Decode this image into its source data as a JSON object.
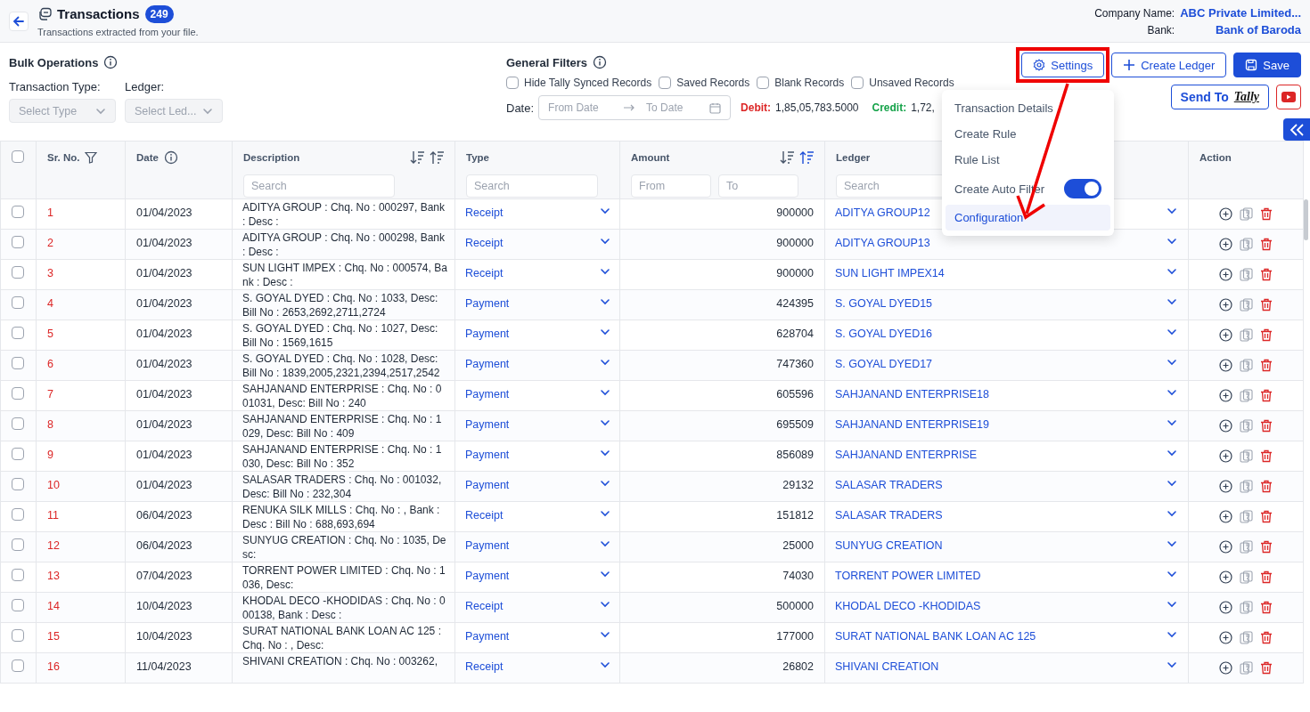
{
  "header": {
    "title": "Transactions",
    "count": "249",
    "subtitle": "Transactions extracted from your file.",
    "company_label": "Company Name:",
    "company": "ABC Private Limited...",
    "bank_label": "Bank:",
    "bank": "Bank of Baroda"
  },
  "bulk_operations": {
    "title": "Bulk Operations",
    "fields": [
      {
        "label": "Transaction Type:",
        "placeholder": "Select Type",
        "disabled": true
      },
      {
        "label": "Ledger:",
        "placeholder": "Select Led...",
        "disabled": true
      }
    ]
  },
  "general_filters": {
    "title": "General Filters",
    "checkboxes": [
      {
        "label": "Hide Tally Synced Records",
        "checked": false
      },
      {
        "label": "Saved Records",
        "checked": false
      },
      {
        "label": "Blank Records",
        "checked": false
      },
      {
        "label": "Unsaved Records",
        "checked": false
      }
    ],
    "date_label": "Date:",
    "from_placeholder": "From Date",
    "to_placeholder": "To Date",
    "debit_label": "Debit:",
    "debit": "1,85,05,783.5000",
    "credit_label": "Credit:",
    "credit": "1,72,"
  },
  "toolbar": {
    "buttons": [
      {
        "label": "Settings",
        "kind": "settings",
        "highlighted": true
      },
      {
        "label": "Create Ledger",
        "kind": "create",
        "highlighted": false
      },
      {
        "label": "Save",
        "kind": "save",
        "highlighted": false
      }
    ],
    "send_to": "Send To",
    "send_logo": "Tally"
  },
  "settings_menu": {
    "items": [
      {
        "label": "Transaction Details",
        "kind": "item",
        "selected": false
      },
      {
        "label": "Create Rule",
        "kind": "item",
        "selected": false
      },
      {
        "label": "Rule List",
        "kind": "item",
        "selected": false
      },
      {
        "label": "Create Auto Filter",
        "kind": "toggle",
        "on": true,
        "selected": false
      },
      {
        "label": "Configuration",
        "kind": "item",
        "selected": true
      }
    ]
  },
  "annotation_arrow": true,
  "table": {
    "select_all_checked": false,
    "columns": [
      {
        "label": "Sr. No.",
        "kind": "filter"
      },
      {
        "label": "Date",
        "kind": "info"
      },
      {
        "label": "Description",
        "kind": "search",
        "search_placeholder": "Search",
        "sort_ascending": false
      },
      {
        "label": "Type",
        "kind": "search",
        "search_placeholder": "Search"
      },
      {
        "label": "Amount",
        "kind": "range",
        "from_placeholder": "From",
        "to_placeholder": "To",
        "sort_ascending": true
      },
      {
        "label": "Ledger",
        "kind": "search",
        "search_placeholder": "Search"
      },
      {
        "label": "Action",
        "kind": "plain"
      }
    ],
    "rows": [
      {
        "sr": "1",
        "date": "01/04/2023",
        "description": "ADITYA GROUP : Chq. No : 000297, Bank : Desc :",
        "type": "Receipt",
        "amount": "900000",
        "ledger": "ADITYA GROUP12",
        "checked": false
      },
      {
        "sr": "2",
        "date": "01/04/2023",
        "description": "ADITYA GROUP : Chq. No : 000298, Bank : Desc :",
        "type": "Receipt",
        "amount": "900000",
        "ledger": "ADITYA GROUP13",
        "checked": false
      },
      {
        "sr": "3",
        "date": "01/04/2023",
        "description": "SUN LIGHT IMPEX : Chq. No : 000574, Bank : Desc :",
        "type": "Receipt",
        "amount": "900000",
        "ledger": "SUN LIGHT IMPEX14",
        "checked": false
      },
      {
        "sr": "4",
        "date": "01/04/2023",
        "description": "S. GOYAL DYED : Chq. No : 1033, Desc: Bill No : 2653,2692,2711,2724",
        "type": "Payment",
        "amount": "424395",
        "ledger": "S. GOYAL DYED15",
        "checked": false
      },
      {
        "sr": "5",
        "date": "01/04/2023",
        "description": "S. GOYAL DYED : Chq. No : 1027, Desc: Bill No : 1569,1615",
        "type": "Payment",
        "amount": "628704",
        "ledger": "S. GOYAL DYED16",
        "checked": false
      },
      {
        "sr": "6",
        "date": "01/04/2023",
        "description": "S. GOYAL DYED : Chq. No : 1028, Desc: Bill No : 1839,2005,2321,2394,2517,2542",
        "type": "Payment",
        "amount": "747360",
        "ledger": "S. GOYAL DYED17",
        "checked": false
      },
      {
        "sr": "7",
        "date": "01/04/2023",
        "description": "SAHJANAND ENTERPRISE : Chq. No : 001031, Desc: Bill No : 240",
        "type": "Payment",
        "amount": "605596",
        "ledger": "SAHJANAND ENTERPRISE18",
        "checked": false
      },
      {
        "sr": "8",
        "date": "01/04/2023",
        "description": "SAHJANAND ENTERPRISE : Chq. No : 1029, Desc: Bill No : 409",
        "type": "Payment",
        "amount": "695509",
        "ledger": "SAHJANAND ENTERPRISE19",
        "checked": false
      },
      {
        "sr": "9",
        "date": "01/04/2023",
        "description": "SAHJANAND ENTERPRISE : Chq. No : 1030, Desc: Bill No : 352",
        "type": "Payment",
        "amount": "856089",
        "ledger": "SAHJANAND ENTERPRISE",
        "checked": false
      },
      {
        "sr": "10",
        "date": "01/04/2023",
        "description": "SALASAR TRADERS : Chq. No : 001032, Desc: Bill No : 232,304",
        "type": "Payment",
        "amount": "29132",
        "ledger": "SALASAR TRADERS",
        "checked": false
      },
      {
        "sr": "11",
        "date": "06/04/2023",
        "description": "RENUKA SILK MILLS : Chq. No : , Bank : Desc : Bill No : 688,693,694",
        "type": "Receipt",
        "amount": "151812",
        "ledger": "SALASAR TRADERS",
        "checked": false
      },
      {
        "sr": "12",
        "date": "06/04/2023",
        "description": "SUNYUG CREATION : Chq. No : 1035, Desc:",
        "type": "Payment",
        "amount": "25000",
        "ledger": "SUNYUG CREATION",
        "checked": false
      },
      {
        "sr": "13",
        "date": "07/04/2023",
        "description": "TORRENT POWER LIMITED : Chq. No : 1036, Desc:",
        "type": "Payment",
        "amount": "74030",
        "ledger": "TORRENT POWER LIMITED",
        "checked": false
      },
      {
        "sr": "14",
        "date": "10/04/2023",
        "description": "KHODAL DECO -KHODIDAS : Chq. No : 000138, Bank : Desc :",
        "type": "Receipt",
        "amount": "500000",
        "ledger": "KHODAL DECO -KHODIDAS",
        "checked": false
      },
      {
        "sr": "15",
        "date": "10/04/2023",
        "description": "SURAT NATIONAL BANK LOAN AC 125 : Chq. No : , Desc:",
        "type": "Payment",
        "amount": "177000",
        "ledger": "SURAT NATIONAL BANK LOAN AC 125",
        "checked": false
      },
      {
        "sr": "16",
        "date": "11/04/2023",
        "description": "SHIVANI CREATION : Chq. No : 003262,",
        "type": "Receipt",
        "amount": "26802",
        "ledger": "SHIVANI CREATION",
        "checked": false
      }
    ]
  }
}
